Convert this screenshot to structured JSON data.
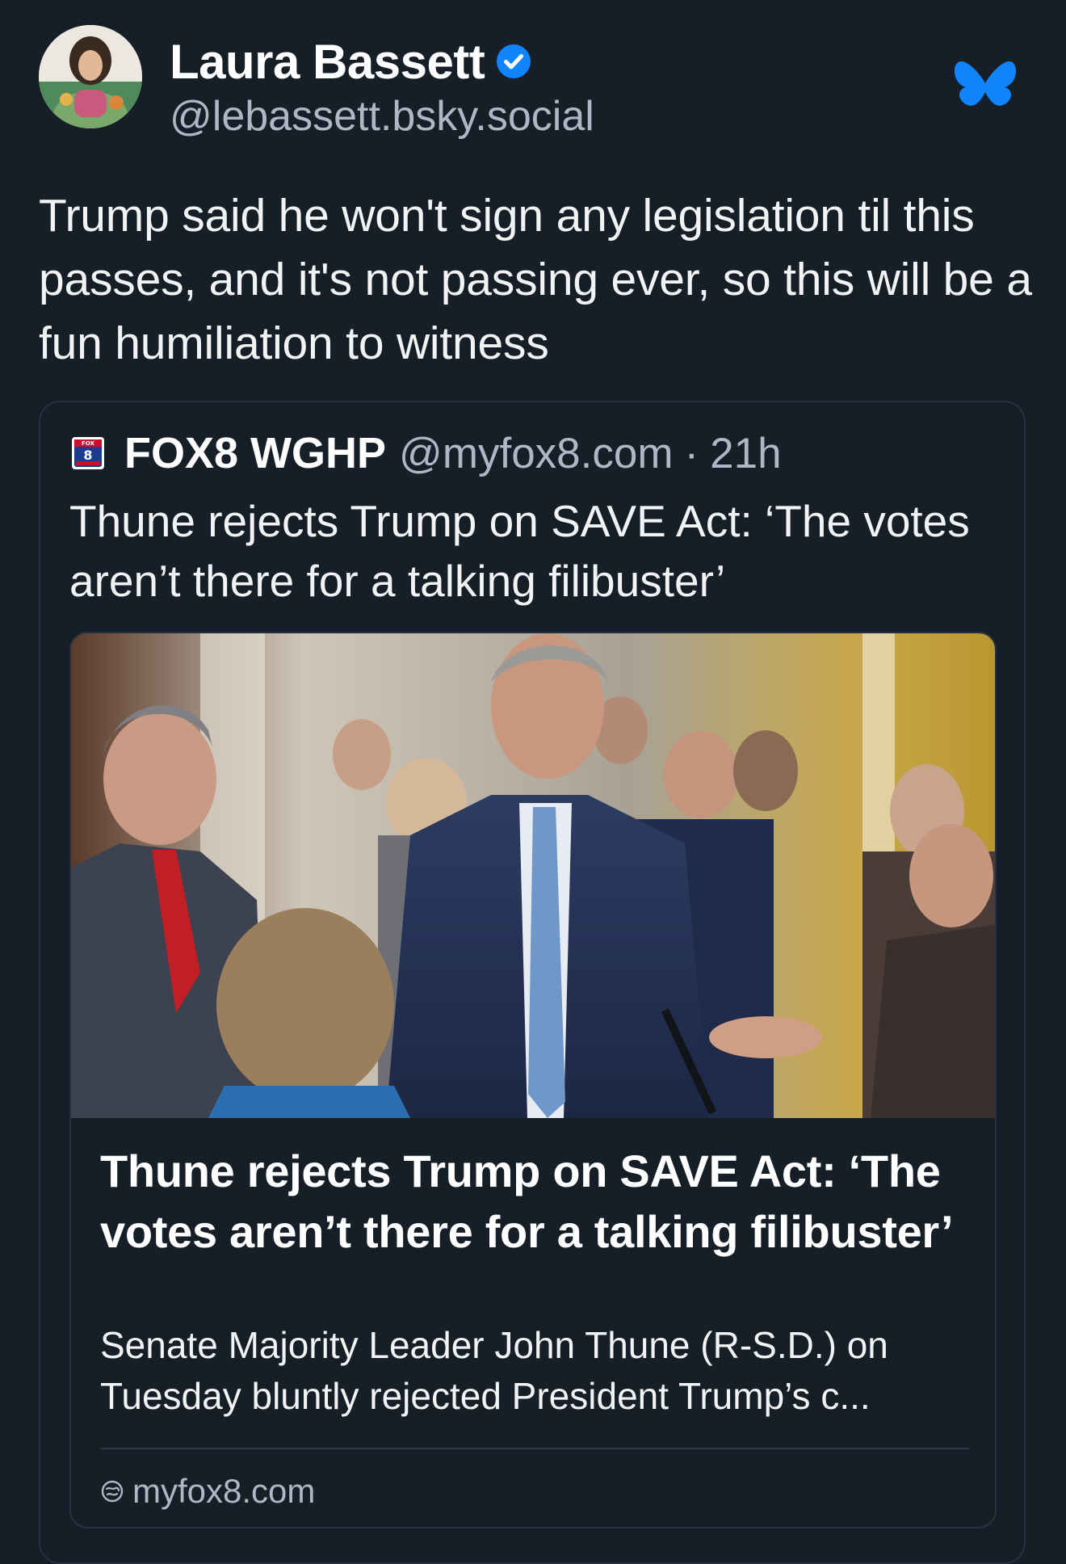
{
  "post": {
    "author_name": "Laura Bassett",
    "author_handle": "@lebassett.bsky.social",
    "verified": true,
    "text": "Trump said he won't sign any legislation til this passes, and it's not passing ever, so this will be a fun humiliation to witness",
    "app_icon": "butterfly-icon"
  },
  "quote": {
    "author_name": "FOX8 WGHP",
    "author_handle": "@myfox8.com",
    "separator": "·",
    "time": "21h",
    "text": "Thune rejects Trump on SAVE Act: ‘The votes aren’t there for a talking filibuster’",
    "logo_text": "FOX 8 WGHP"
  },
  "link_card": {
    "title": "Thune rejects Trump on SAVE Act: ‘The votes aren’t there for a talking filibuster’",
    "description": "Senate Majority Leader John Thune (R-S.D.) on Tuesday bluntly rejected President Trump’s c...",
    "domain": "myfox8.com",
    "domain_icon": "globe-icon"
  },
  "colors": {
    "background": "#161e27",
    "accent_blue": "#1185fe",
    "secondary_text": "#aeb8c4",
    "border": "#283341"
  }
}
